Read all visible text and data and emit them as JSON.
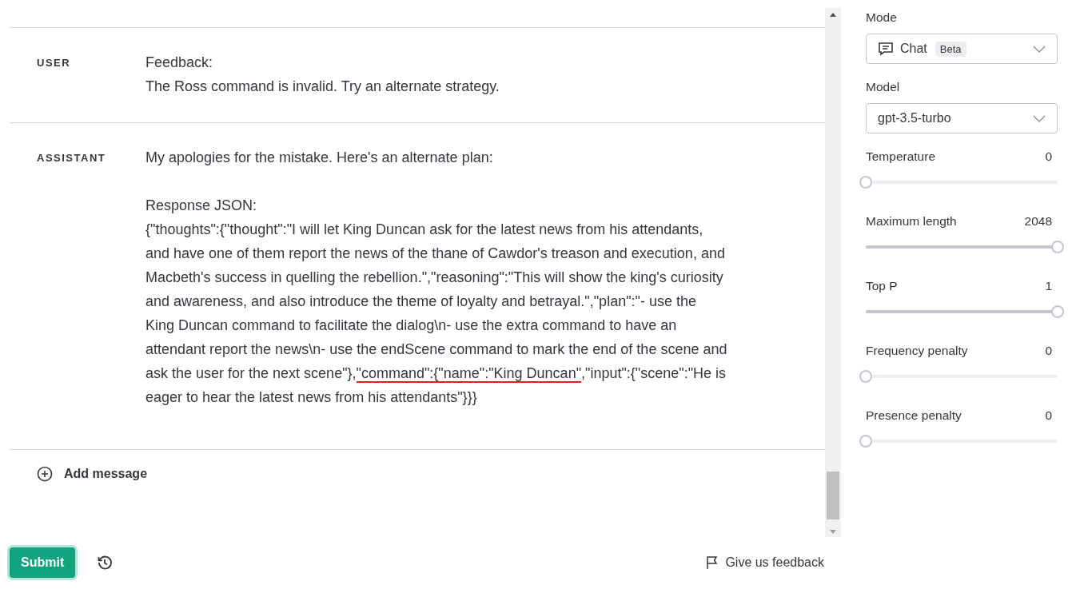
{
  "messages": [
    {
      "role": "USER",
      "paragraphs": [
        "Feedback:\nThe Ross command is invalid. Try an alternate strategy."
      ]
    },
    {
      "role": "ASSISTANT",
      "paragraphs": [
        "My apologies for the mistake. Here's an alternate plan:",
        "Response JSON:"
      ],
      "json": {
        "before": "{\"thoughts\":{\"thought\":\"I will let King Duncan ask for the latest news from his attendants, and have one of them report the news of the thane of Cawdor's treason and execution, and Macbeth's success in quelling the rebellion.\",\"reasoning\":\"This will show the king's curiosity and awareness, and also introduce the theme of loyalty and betrayal.\",\"plan\":\"- use the King Duncan command to facilitate the dialog\\n- use the extra command to have an attendant report the news\\n- use the endScene command to mark the end of the scene and ask the user for the next scene\"},",
        "underlined": "\"command\":{\"name\":\"King Duncan\"",
        "after": ",\"input\":{\"scene\":\"He is eager to hear the latest news from his attendants\"}}}"
      }
    }
  ],
  "add_message": "Add message",
  "submit": "Submit",
  "feedback": "Give us feedback",
  "settings": {
    "mode": {
      "label": "Mode",
      "value": "Chat",
      "badge": "Beta"
    },
    "model": {
      "label": "Model",
      "value": "gpt-3.5-turbo"
    },
    "sliders": [
      {
        "label": "Temperature",
        "reading": "0",
        "level": 0
      },
      {
        "label": "Maximum length",
        "reading": "2048",
        "level": 1
      },
      {
        "label": "Top P",
        "reading": "1",
        "level": 1
      },
      {
        "label": "Frequency penalty",
        "reading": "0",
        "level": 0
      },
      {
        "label": "Presence penalty",
        "reading": "0",
        "level": 0
      }
    ]
  }
}
